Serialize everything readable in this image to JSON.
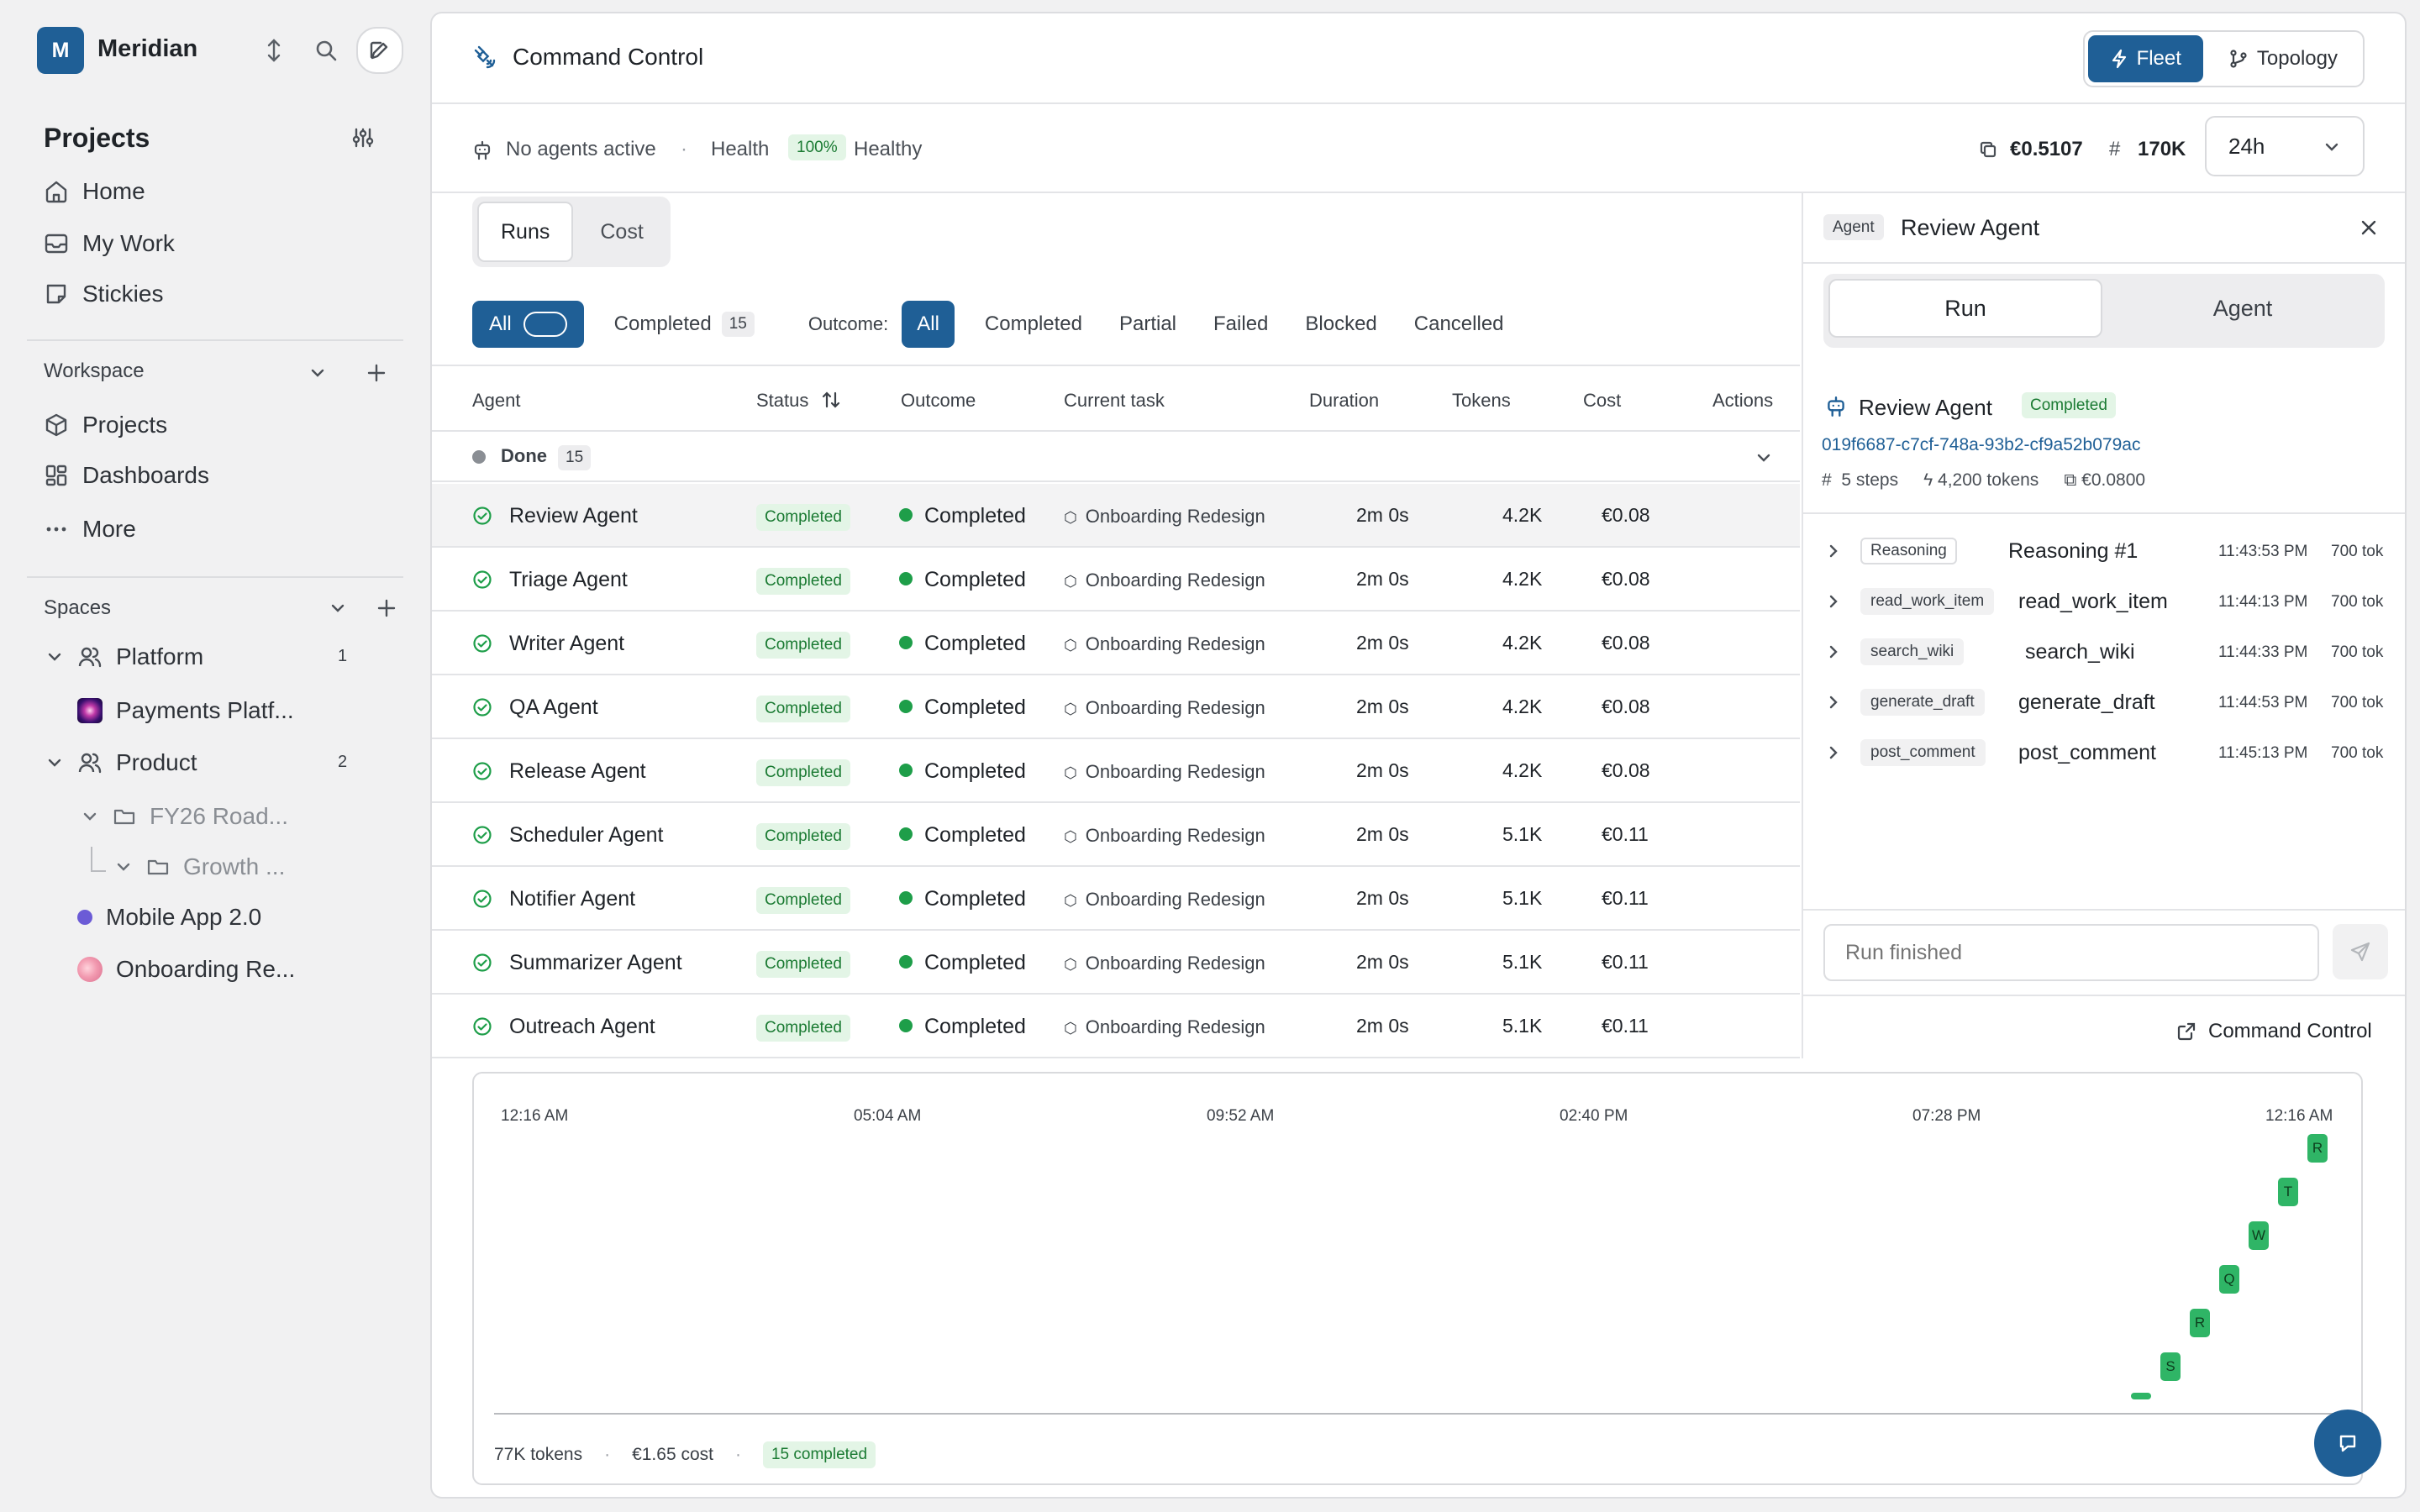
{
  "sidebar": {
    "workspace_initial": "M",
    "workspace_name": "Meridian",
    "section_title": "Projects",
    "nav": [
      {
        "label": "Home",
        "icon": "home-icon"
      },
      {
        "label": "My Work",
        "icon": "inbox-icon"
      },
      {
        "label": "Stickies",
        "icon": "sticky-note-icon"
      }
    ],
    "workspace_label": "Workspace",
    "workspace_items": [
      {
        "label": "Projects",
        "icon": "cube-icon"
      },
      {
        "label": "Dashboards",
        "icon": "dashboard-icon"
      },
      {
        "label": "More",
        "icon": "more-icon"
      }
    ],
    "spaces_label": "Spaces",
    "spaces": {
      "platform": {
        "label": "Platform",
        "count": "1"
      },
      "payments": "Payments Platf...",
      "product": {
        "label": "Product",
        "count": "2"
      },
      "fy26": "FY26 Road...",
      "growth": "Growth ...",
      "mobile": "Mobile App 2.0",
      "onboarding": "Onboarding Re..."
    }
  },
  "header": {
    "title": "Command Control",
    "views": [
      {
        "label": "Fleet"
      },
      {
        "label": "Topology"
      }
    ]
  },
  "status": {
    "agents": "No agents active",
    "sep": "·",
    "health_label": "Health",
    "health_value": "100%",
    "health_state": "Healthy",
    "cost": "€0.5107",
    "tokens": "170K",
    "range": "24h"
  },
  "runs": {
    "tabs": [
      "Runs",
      "Cost"
    ],
    "filters": {
      "all": "All",
      "completed": "Completed",
      "completed_count": "15",
      "outcome_label": "Outcome:",
      "outcomes": [
        "All",
        "Completed",
        "Partial",
        "Failed",
        "Blocked",
        "Cancelled"
      ]
    },
    "columns": [
      "Agent",
      "Status",
      "Outcome",
      "Current task",
      "Duration",
      "Tokens",
      "Cost",
      "Actions"
    ],
    "group": {
      "label": "Done",
      "count": "15"
    },
    "rows": [
      {
        "agent": "Review Agent",
        "status": "Completed",
        "outcome": "Completed",
        "task": "Onboarding Redesign",
        "duration": "2m 0s",
        "tokens": "4.2K",
        "cost": "€0.08"
      },
      {
        "agent": "Triage Agent",
        "status": "Completed",
        "outcome": "Completed",
        "task": "Onboarding Redesign",
        "duration": "2m 0s",
        "tokens": "4.2K",
        "cost": "€0.08"
      },
      {
        "agent": "Writer Agent",
        "status": "Completed",
        "outcome": "Completed",
        "task": "Onboarding Redesign",
        "duration": "2m 0s",
        "tokens": "4.2K",
        "cost": "€0.08"
      },
      {
        "agent": "QA Agent",
        "status": "Completed",
        "outcome": "Completed",
        "task": "Onboarding Redesign",
        "duration": "2m 0s",
        "tokens": "4.2K",
        "cost": "€0.08"
      },
      {
        "agent": "Release Agent",
        "status": "Completed",
        "outcome": "Completed",
        "task": "Onboarding Redesign",
        "duration": "2m 0s",
        "tokens": "4.2K",
        "cost": "€0.08"
      },
      {
        "agent": "Scheduler Agent",
        "status": "Completed",
        "outcome": "Completed",
        "task": "Onboarding Redesign",
        "duration": "2m 0s",
        "tokens": "5.1K",
        "cost": "€0.11"
      },
      {
        "agent": "Notifier Agent",
        "status": "Completed",
        "outcome": "Completed",
        "task": "Onboarding Redesign",
        "duration": "2m 0s",
        "tokens": "5.1K",
        "cost": "€0.11"
      },
      {
        "agent": "Summarizer Agent",
        "status": "Completed",
        "outcome": "Completed",
        "task": "Onboarding Redesign",
        "duration": "2m 0s",
        "tokens": "5.1K",
        "cost": "€0.11"
      },
      {
        "agent": "Outreach Agent",
        "status": "Completed",
        "outcome": "Completed",
        "task": "Onboarding Redesign",
        "duration": "2m 0s",
        "tokens": "5.1K",
        "cost": "€0.11"
      }
    ]
  },
  "detail": {
    "badge": "Agent",
    "title": "Review Agent",
    "tabs": [
      "Run",
      "Agent"
    ],
    "run_name": "Review Agent",
    "run_status": "Completed",
    "run_id": "019f6687-c7cf-748a-93b2-cf9a52b079ac",
    "steps_count": "5 steps",
    "tokens": "4,200 tokens",
    "cost": "€0.0800",
    "steps": [
      {
        "tag": "Reasoning",
        "name": "Reasoning #1",
        "time": "11:43:53 PM",
        "tok": "700 tok"
      },
      {
        "tag": "read_work_item",
        "name": "read_work_item",
        "time": "11:44:13 PM",
        "tok": "700 tok"
      },
      {
        "tag": "search_wiki",
        "name": "search_wiki",
        "time": "11:44:33 PM",
        "tok": "700 tok"
      },
      {
        "tag": "generate_draft",
        "name": "generate_draft",
        "time": "11:44:53 PM",
        "tok": "700 tok"
      },
      {
        "tag": "post_comment",
        "name": "post_comment",
        "time": "11:45:13 PM",
        "tok": "700 tok"
      }
    ],
    "input_placeholder": "Run finished",
    "footer_link": "Command Control"
  },
  "timeline": {
    "ticks": [
      "12:16 AM",
      "05:04 AM",
      "09:52 AM",
      "02:40 PM",
      "07:28 PM",
      "12:16 AM"
    ],
    "marks": [
      "R",
      "T",
      "W",
      "Q",
      "R",
      "S"
    ],
    "summary_tokens": "77K tokens",
    "summary_cost": "€1.65 cost",
    "summary_completed": "15 completed",
    "sep": "·"
  },
  "colors": {
    "accent": "#1f5f96",
    "success": "#1e9e49"
  }
}
